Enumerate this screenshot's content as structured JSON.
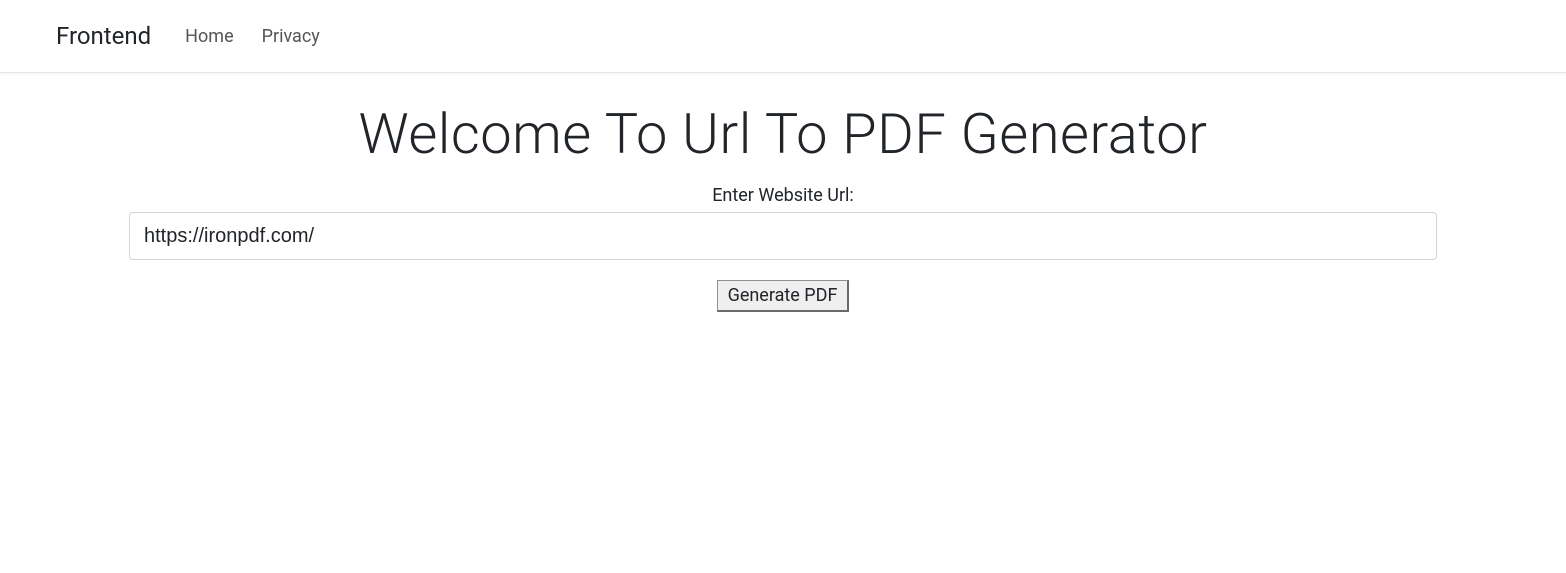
{
  "navbar": {
    "brand": "Frontend",
    "links": [
      {
        "label": "Home"
      },
      {
        "label": "Privacy"
      }
    ]
  },
  "main": {
    "title": "Welcome To Url To PDF Generator",
    "url_label": "Enter Website Url:",
    "url_value": "https://ironpdf.com/",
    "generate_button": "Generate PDF"
  }
}
